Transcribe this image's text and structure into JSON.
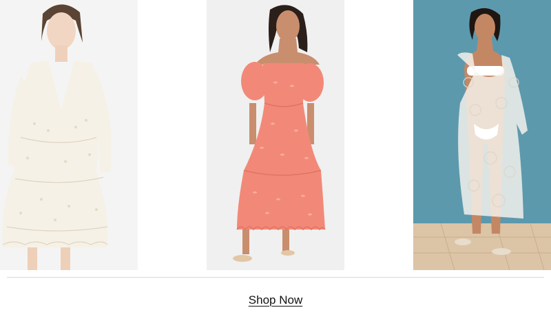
{
  "products": [
    {
      "image": "white-eyelet-lace-dress-image",
      "background": "#f4f4f4",
      "dress_color": "#f6f1e6"
    },
    {
      "image": "coral-off-shoulder-eyelet-dress-image",
      "background": "#f0f0f0",
      "dress_color": "#f28978"
    },
    {
      "image": "white-lace-cover-up-image",
      "background": "#5d99ad",
      "dress_color": "#f7f4ee"
    }
  ],
  "cta": {
    "label": "Shop Now"
  }
}
